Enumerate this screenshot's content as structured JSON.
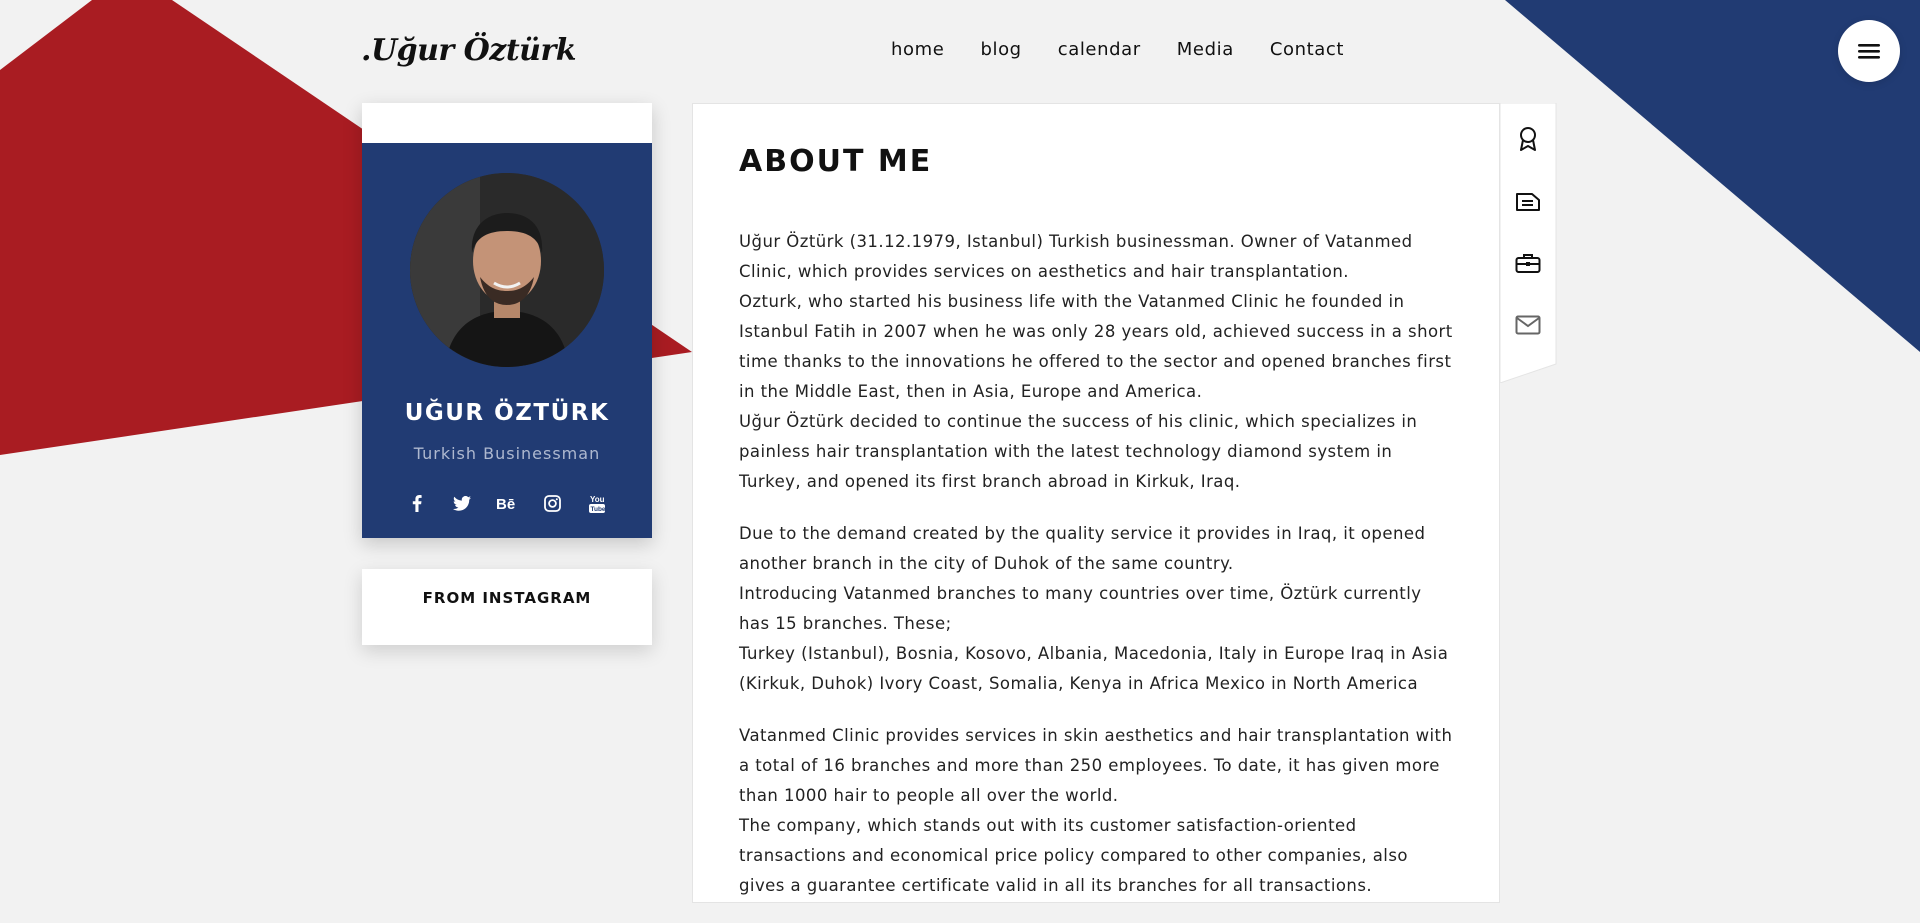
{
  "brand": {
    "logo": ".Uğur Öztürk"
  },
  "nav": {
    "items": [
      "home",
      "blog",
      "calendar",
      "Media",
      "Contact"
    ]
  },
  "menu": {
    "icon": "hamburger-icon"
  },
  "colors": {
    "red": "#a91c22",
    "blue": "#213b73",
    "background": "#f2f2f2"
  },
  "profile": {
    "name": "UĞUR ÖZTÜRK",
    "role": "Turkish Businessman",
    "socials": [
      "facebook-icon",
      "twitter-icon",
      "behance-icon",
      "instagram-icon",
      "youtube-icon"
    ]
  },
  "instagram": {
    "title": "FROM INSTAGRAM"
  },
  "about": {
    "title": "ABOUT ME",
    "paragraphs": [
      "Uğur Öztürk (31.12.1979, Istanbul) Turkish businessman. Owner of Vatanmed Clinic, which provides services on aesthetics and hair transplantation.",
      "Ozturk, who started his business life with the Vatanmed Clinic he founded in Istanbul Fatih in 2007 when he was only 28 years old, achieved success in a short time thanks to the innovations he offered to the sector and opened branches first in the Middle East, then in Asia, Europe and America.",
      "Uğur Öztürk decided to continue the success of his clinic, which specializes in painless hair transplantation with the latest technology diamond system in Turkey, and opened its first branch abroad in Kirkuk, Iraq.",
      "Due to the demand created by the quality service it provides in Iraq, it opened another branch in the city of Duhok of the same country.",
      "Introducing Vatanmed branches to many countries over time, Öztürk currently has 15 branches. These;",
      "Turkey (Istanbul), Bosnia, Kosovo, Albania, Macedonia, Italy in Europe Iraq in Asia (Kirkuk, Duhok) Ivory Coast, Somalia, Kenya in Africa Mexico in North America",
      "Vatanmed Clinic provides services in skin aesthetics and hair transplantation with a total of 16 branches and more than 250 employees. To date, it has given more than 1000 hair to people all over the world.",
      "The company, which stands out with its customer satisfaction-oriented transactions and economical price policy compared to other companies, also gives a guarantee certificate valid in all its branches for all transactions."
    ]
  },
  "side_tabs": [
    "award-icon",
    "resume-icon",
    "briefcase-icon",
    "mail-icon"
  ]
}
